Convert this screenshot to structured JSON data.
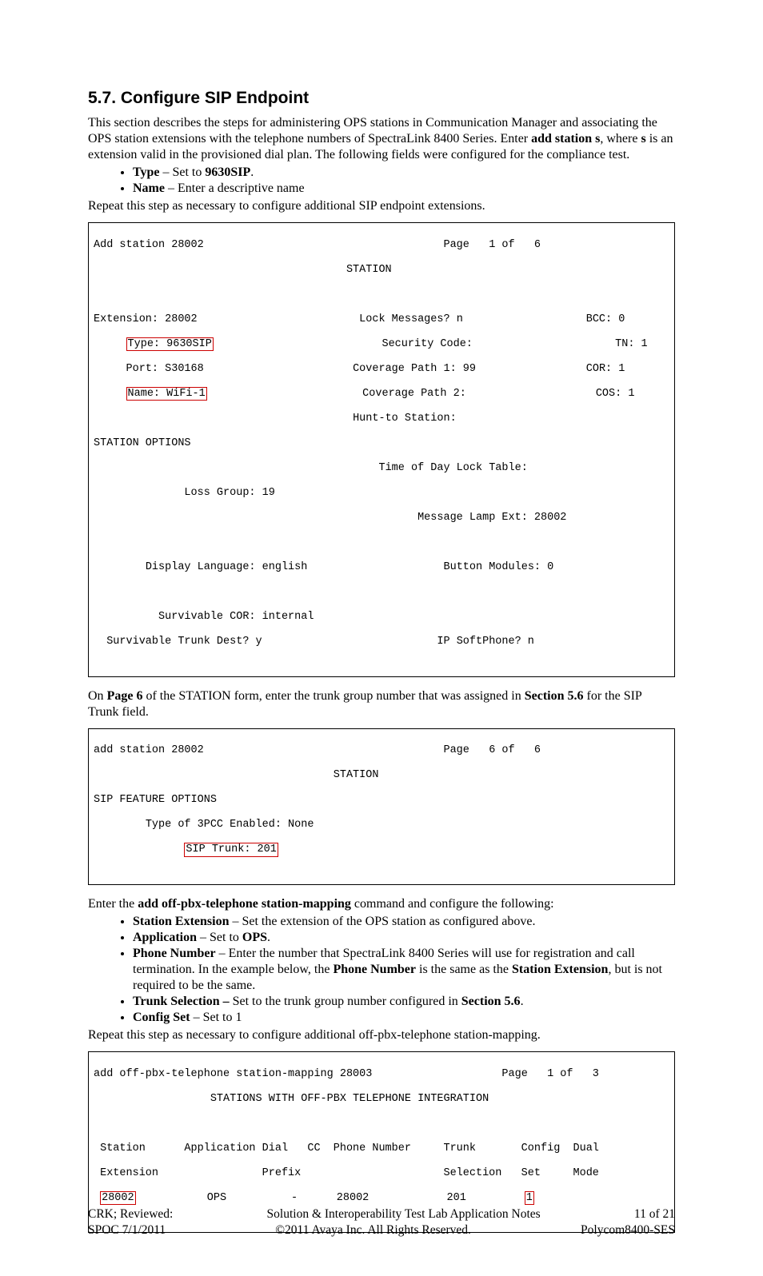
{
  "heading": {
    "number": "5.7.",
    "title": "Configure SIP Endpoint"
  },
  "intro": {
    "para1a": "This section describes the steps for administering OPS stations in Communication Manager and associating the OPS station extensions with the telephone numbers of SpectraLink 8400 Series. Enter ",
    "cmd": "add station s",
    "para1b": ", where ",
    "s": "s",
    "para1c": " is an extension valid in the provisioned dial plan.  The following fields were configured for the compliance test.",
    "bullet1_label": "Type",
    "bullet1_mid": " – Set to ",
    "bullet1_val": "9630SIP",
    "bullet1_end": ".",
    "bullet2_label": "Name",
    "bullet2_rest": " – Enter a descriptive name",
    "repeat": "Repeat this step as necessary to configure additional SIP endpoint extensions."
  },
  "screen1": {
    "top_left": "Add station 28002",
    "top_right": "Page   1 of   6",
    "title": "STATION",
    "l1a": "Extension: 28002",
    "l1b": "Lock Messages? n",
    "l1c": "BCC: 0",
    "l2a": "Type: 9630SIP",
    "l2b": "Security Code:",
    "l2c": "TN: 1",
    "l3a": "Port: S30168",
    "l3b": "Coverage Path 1: 99",
    "l3c": "COR: 1",
    "l4a": "Name: WiFi-1",
    "l4b": "Coverage Path 2:",
    "l4c": "COS: 1",
    "l5b": "Hunt-to Station:",
    "opts": "STATION OPTIONS",
    "tod": "Time of Day Lock Table:",
    "loss": "Loss Group: 19",
    "mle": "Message Lamp Ext: 28002",
    "dlang": "Display Language: english",
    "btnmod": "Button Modules: 0",
    "scor": "Survivable COR: internal",
    "std_l": "Survivable Trunk Dest? y",
    "std_r": "IP SoftPhone? n"
  },
  "mid": {
    "a": "On ",
    "page6": "Page 6",
    "b": " of the STATION form, enter the trunk group number that was assigned in ",
    "sec56": "Section 5.6",
    "c": " for the SIP Trunk field."
  },
  "screen2": {
    "top_left": "add station 28002",
    "top_right": "Page   6 of   6",
    "title": "STATION",
    "sfo": "SIP FEATURE OPTIONS",
    "t3pcc": "Type of 3PCC Enabled: None",
    "sip": "SIP Trunk: 201"
  },
  "off": {
    "intro_a": "Enter the ",
    "cmd": "add off-pbx-telephone station-mapping",
    "intro_b": " command and configure the following:",
    "b1_label": "Station Extension",
    "b1_rest": " – Set the extension of the OPS station as configured above.",
    "b2_label": "Application",
    "b2_mid": " – Set to ",
    "b2_val": "OPS",
    "b2_end": ".",
    "b3_label": "Phone Number",
    "b3_a": " – Enter the number that SpectraLink 8400 Series will use for registration and call termination. In the example below, the ",
    "b3_pn": "Phone Number",
    "b3_b": " is the same as the ",
    "b3_se": "Station Extension",
    "b3_c": ", but is not required to be the same.",
    "b4_label": "Trunk Selection –",
    "b4_rest": " Set to the trunk group number configured in ",
    "b4_sec": "Section 5.6",
    "b4_end": ".",
    "b5_label": "Config Set",
    "b5_rest": " – Set to 1",
    "repeat": "Repeat this step as necessary to configure additional off-pbx-telephone station-mapping."
  },
  "screen3": {
    "top_left": "add off-pbx-telephone station-mapping 28003",
    "top_right": "Page   1 of   3",
    "title": "STATIONS WITH OFF-PBX TELEPHONE INTEGRATION",
    "hdr1a": " Station      Application Dial   CC  Phone Number     Trunk       Config  Dual",
    "hdr1b": " Extension                Prefix                      Selection   Set     Mode",
    "row_pre": " ",
    "row_ext": "28002",
    "row_mid": "           OPS          -      28002            201         ",
    "row_cfg": "1"
  },
  "footer": {
    "l1": "CRK; Reviewed:",
    "l2": "SPOC 7/1/2011",
    "c1": "Solution & Interoperability Test Lab Application Notes",
    "c2": "©2011 Avaya Inc. All Rights Reserved.",
    "r1": "11 of 21",
    "r2": "Polycom8400-SES"
  }
}
